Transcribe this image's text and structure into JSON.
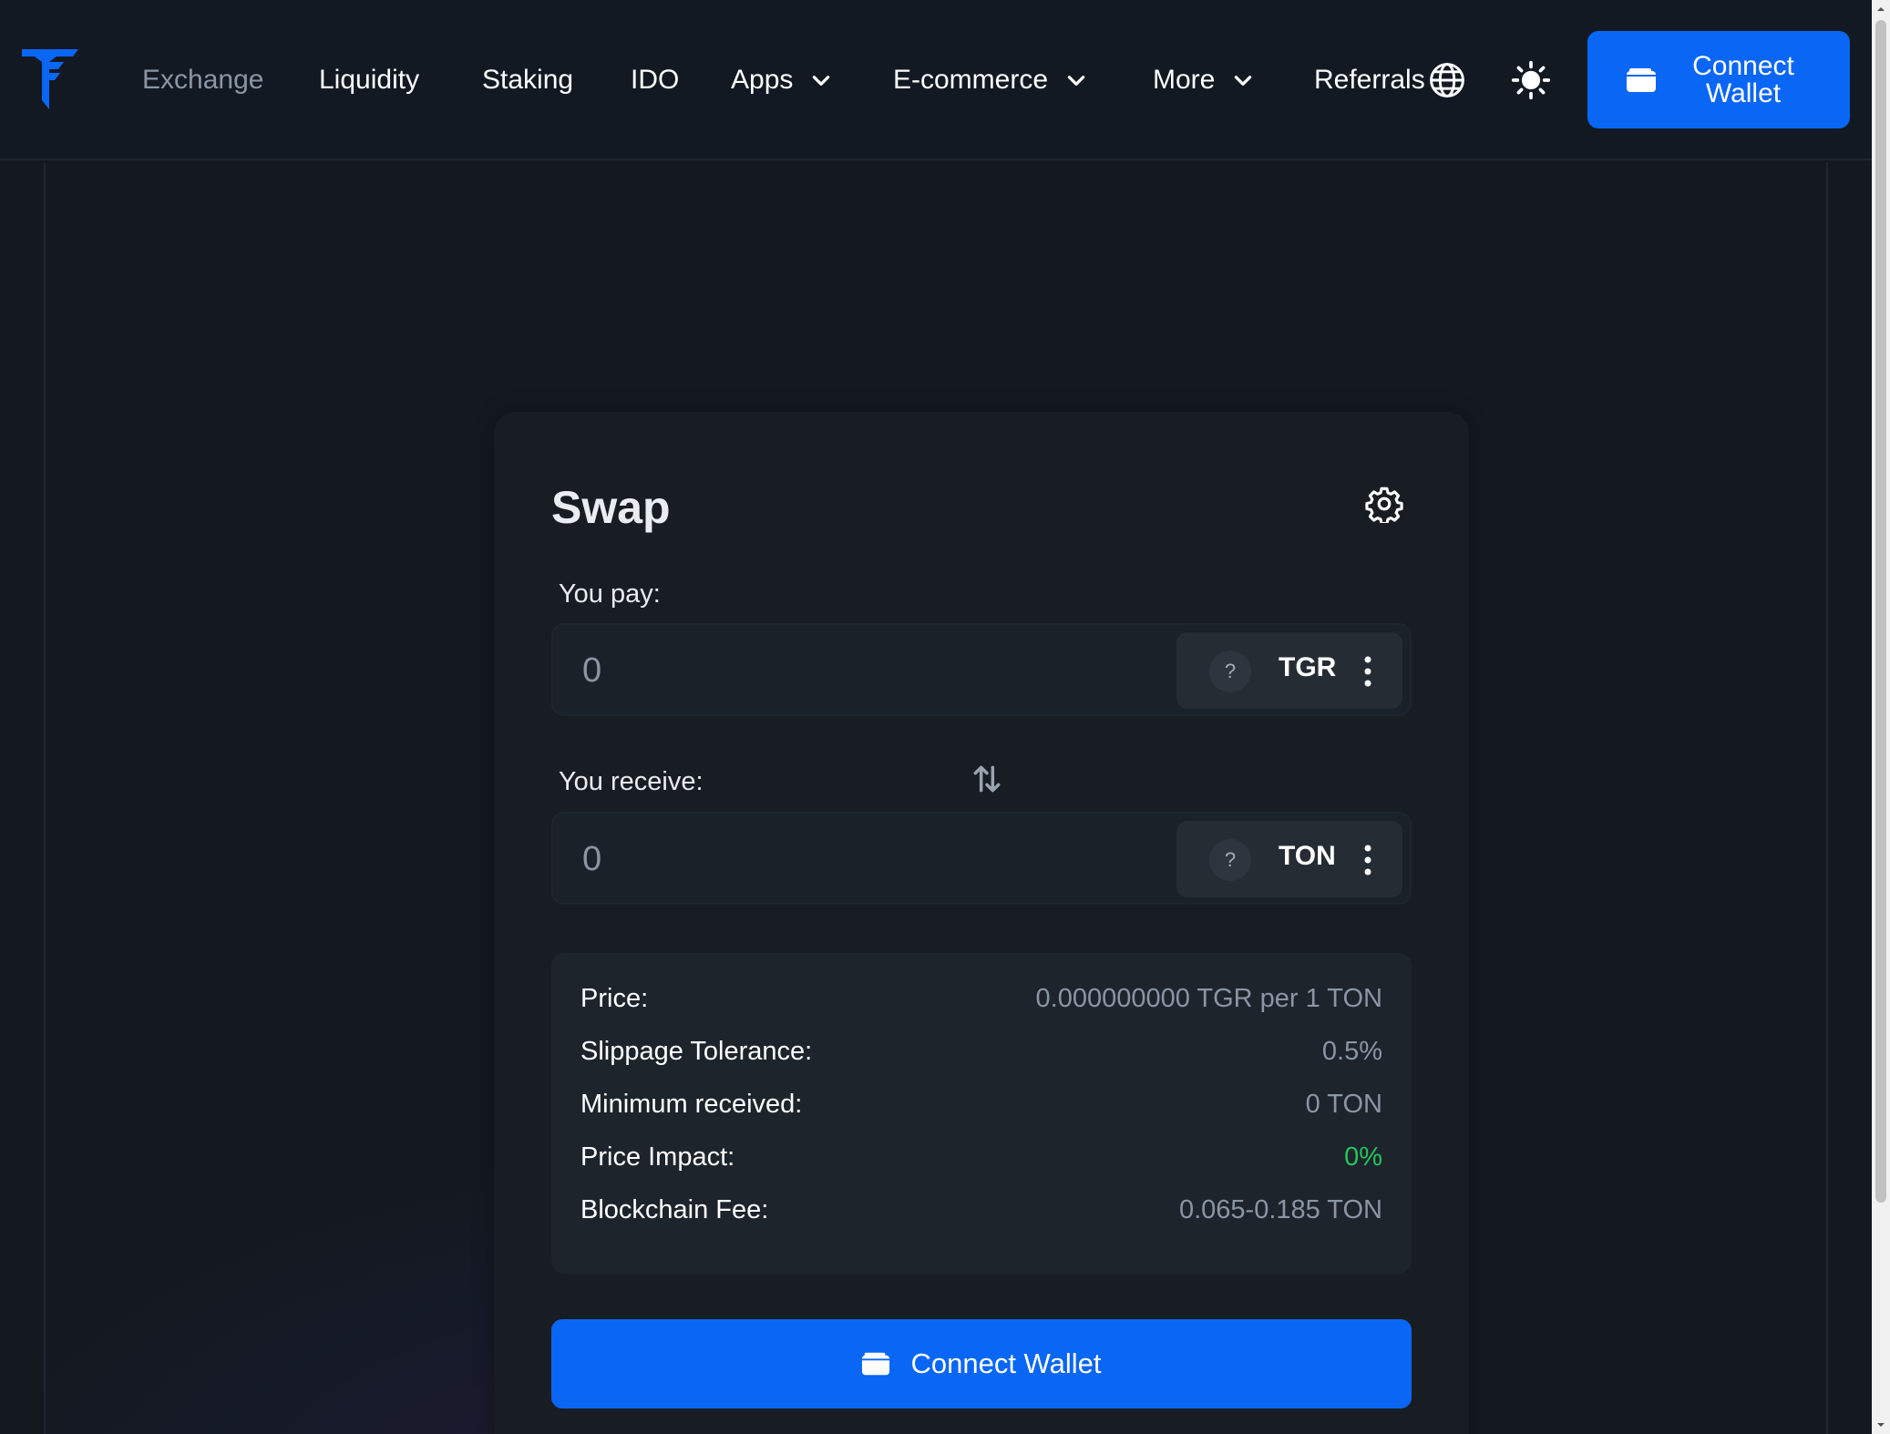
{
  "nav": {
    "items": [
      {
        "label": "Exchange",
        "active": true
      },
      {
        "label": "Liquidity"
      },
      {
        "label": "Staking"
      },
      {
        "label": "IDO"
      },
      {
        "label": "Apps",
        "dropdown": true
      },
      {
        "label": "E-commerce",
        "dropdown": true
      },
      {
        "label": "More",
        "dropdown": true
      },
      {
        "label": "Referrals"
      }
    ],
    "language_icon": "globe-icon",
    "theme_icon": "sun-icon",
    "connect_label": "Connect Wallet"
  },
  "swap": {
    "title": "Swap",
    "settings_icon": "gear-icon",
    "pay_label": "You pay:",
    "pay_value": "0",
    "pay_token": {
      "badge": "?",
      "symbol": "TGR"
    },
    "receive_label": "You receive:",
    "receive_value": "0",
    "receive_token": {
      "badge": "?",
      "symbol": "TON"
    },
    "switch_icon": "swap-arrows-icon",
    "info": [
      {
        "key": "Price:",
        "value": "0.000000000 TGR per 1 TON"
      },
      {
        "key": "Slippage Tolerance:",
        "value": "0.5%"
      },
      {
        "key": "Minimum received:",
        "value": "0 TON"
      },
      {
        "key": "Price Impact:",
        "value": "0%"
      },
      {
        "key": "Blockchain Fee:",
        "value": "0.065-0.185 TON"
      }
    ],
    "connect_label": "Connect Wallet"
  },
  "colors": {
    "accent": "#0a66f5",
    "background": "#141920",
    "card": "#181d23",
    "muted_text": "#8a95a5",
    "positive": "#22c55e"
  }
}
